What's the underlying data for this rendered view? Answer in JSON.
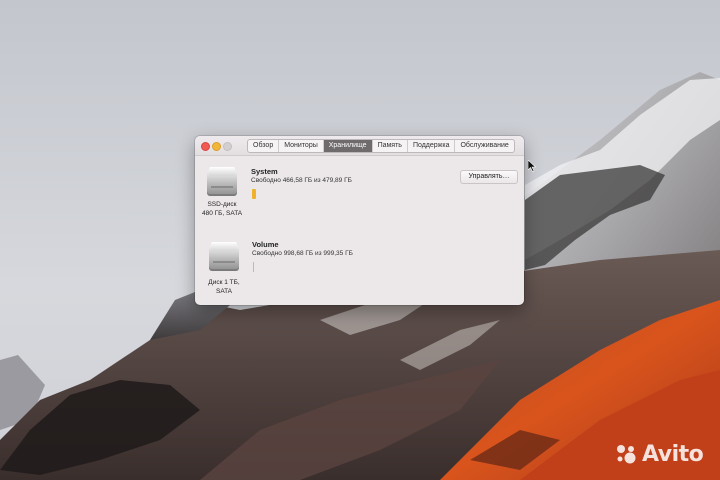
{
  "window": {
    "tabs": [
      {
        "label": "Обзор",
        "active": false
      },
      {
        "label": "Мониторы",
        "active": false
      },
      {
        "label": "Хранилище",
        "active": true
      },
      {
        "label": "Память",
        "active": false
      },
      {
        "label": "Поддержка",
        "active": false
      },
      {
        "label": "Обслуживание",
        "active": false
      }
    ],
    "manage_button": "Управлять…"
  },
  "drives": [
    {
      "volume_name": "System",
      "free_text": "Свободно 466,58 ГБ из 479,89 ГБ",
      "caption_line1": "SSD-диск",
      "caption_line2": "480 ГБ, SATA",
      "used_fraction": 0.03,
      "usage_color": "#f0b12c"
    },
    {
      "volume_name": "Volume",
      "free_text": "Свободно 998,68 ГБ из 999,35 ГБ",
      "caption_line1": "Диск 1 ТБ,",
      "caption_line2": "SATA",
      "used_fraction": 0.001,
      "usage_color": "#b9b9b9"
    }
  ],
  "watermark": {
    "text": "Avito"
  }
}
